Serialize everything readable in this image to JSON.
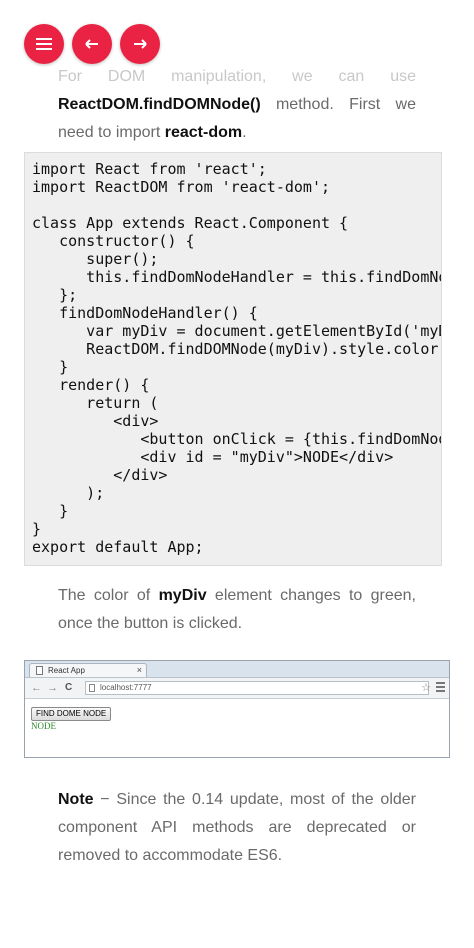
{
  "nav": {
    "menu_icon": "hamburger-menu-icon",
    "prev_icon": "arrow-left-icon",
    "next_icon": "arrow-right-icon",
    "accent_color": "#ea2344"
  },
  "intro": {
    "faded_line": "For DOM manipulation, we can use",
    "method_name": "ReactDOM.findDOMNode()",
    "after_method": " method. First we need to import ",
    "import_name": "react-dom",
    "end": "."
  },
  "code_lines": [
    "import React from 'react';",
    "import ReactDOM from 'react-dom';",
    "",
    "class App extends React.Component {",
    "   constructor() {",
    "      super();",
    "      this.findDomNodeHandler = this.findDomNodeHandler.bind(this);",
    "   };",
    "   findDomNodeHandler() {",
    "      var myDiv = document.getElementById('myDiv');",
    "      ReactDOM.findDOMNode(myDiv).style.color = 'green';",
    "   }",
    "   render() {",
    "      return (",
    "         <div>",
    "            <button onClick = {this.findDomNodeHandler}>FIND DOME NODE</button>",
    "            <div id = \"myDiv\">NODE</div>",
    "         </div>",
    "      );",
    "   }",
    "}",
    "export default App;"
  ],
  "result_text": {
    "before": "The color of ",
    "element": "myDiv",
    "after": " element changes to green, once the button is clicked."
  },
  "browser": {
    "tab_title": "React App",
    "tab_close": "×",
    "back": "←",
    "forward": "→",
    "reload": "C",
    "url": "localhost:7777",
    "star": "☆",
    "button_label": "FIND DOME NODE",
    "node_text": "NODE",
    "node_color": "#2f8a2f"
  },
  "note": {
    "label": "Note",
    "text": " − Since the 0.14 update, most of the older component API methods are deprecated or removed to accommodate ES6."
  }
}
